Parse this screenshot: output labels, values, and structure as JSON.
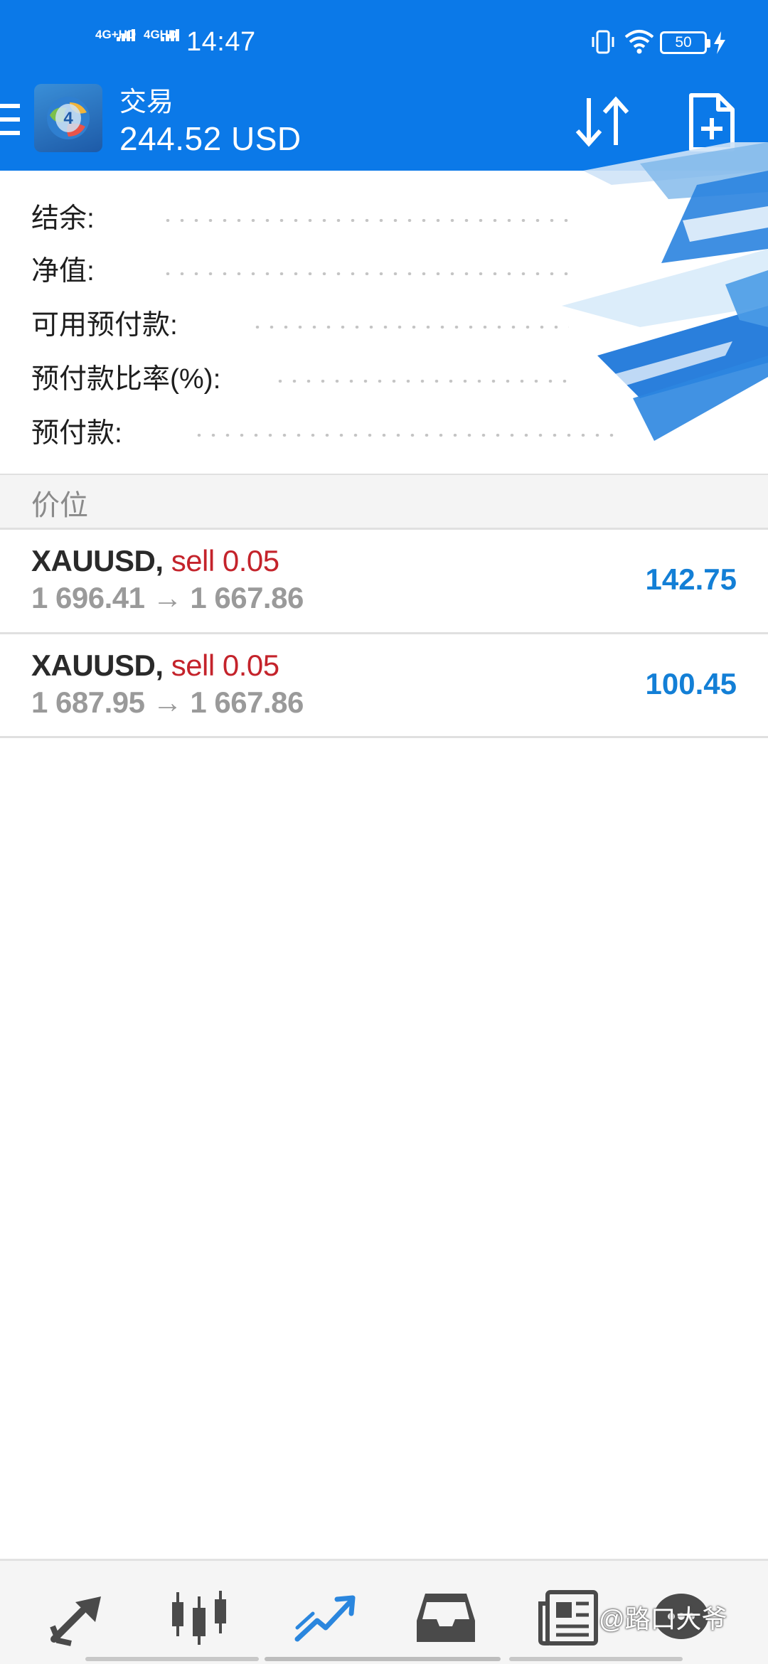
{
  "status_bar": {
    "network1": "4G+HD",
    "network2": "4GHD",
    "time": "14:47",
    "battery": "50"
  },
  "header": {
    "title": "交易",
    "balance": "244.52 USD"
  },
  "summary": {
    "labels": [
      "结余:",
      "净值:",
      "可用预付款:",
      "预付款比率(%):",
      "预付款:"
    ]
  },
  "section": {
    "title": "价位"
  },
  "positions": [
    {
      "symbol": "XAUUSD,",
      "side": "sell 0.05",
      "prices": "1 696.41 → 1 667.86",
      "profit": "142.75"
    },
    {
      "symbol": "XAUUSD,",
      "side": "sell 0.05",
      "prices": "1 687.95 → 1 667.86",
      "profit": "100.45"
    }
  ],
  "bottom_nav": {
    "items": [
      "quotes-icon",
      "chart-icon",
      "trade-icon",
      "history-icon",
      "news-icon",
      "chat-icon"
    ],
    "active": "trade-icon"
  },
  "watermark": "@路口大爷",
  "colors": {
    "brand_blue": "#0b79e8",
    "sell_red": "#c4232b",
    "profit_blue": "#137fd6"
  }
}
